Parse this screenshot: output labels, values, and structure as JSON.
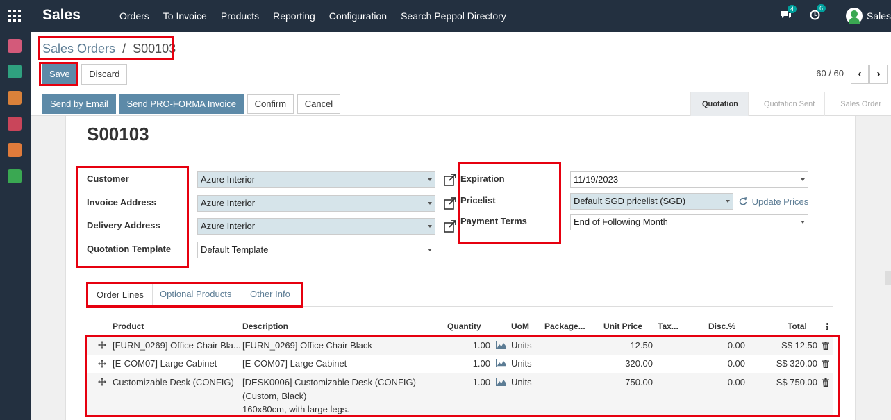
{
  "app": {
    "name": "Sales",
    "menu": [
      "Orders",
      "To Invoice",
      "Products",
      "Reporting",
      "Configuration",
      "Search Peppol Directory"
    ],
    "messages_count": "4",
    "activities_count": "6",
    "user": "Sales"
  },
  "breadcrumb": {
    "parent": "Sales Orders",
    "separator": "/",
    "current": "S00103"
  },
  "buttons": {
    "save": "Save",
    "discard": "Discard"
  },
  "pager": {
    "value": "60 / 60"
  },
  "actions": [
    "Send by Email",
    "Send PRO-FORMA Invoice",
    "Confirm",
    "Cancel"
  ],
  "stages": [
    "Quotation",
    "Quotation Sent",
    "Sales Order"
  ],
  "stage_active": "Quotation",
  "record": {
    "title": "S00103",
    "customer_label": "Customer",
    "customer": "Azure Interior",
    "invoice_label": "Invoice Address",
    "invoice": "Azure Interior",
    "delivery_label": "Delivery Address",
    "delivery": "Azure Interior",
    "template_label": "Quotation Template",
    "template": "Default Template",
    "expiration_label": "Expiration",
    "expiration": "11/19/2023",
    "pricelist_label": "Pricelist",
    "pricelist": "Default SGD pricelist (SGD)",
    "update_prices": "Update Prices",
    "terms_label": "Payment Terms",
    "terms": "End of Following Month"
  },
  "tabs": [
    "Order Lines",
    "Optional Products",
    "Other Info"
  ],
  "columns": [
    "Product",
    "Description",
    "Quantity",
    "UoM",
    "Package...",
    "Unit Price",
    "Tax...",
    "Disc.%",
    "Total"
  ],
  "lines": [
    {
      "product": "[FURN_0269] Office Chair Bla...",
      "description": [
        "[FURN_0269] Office Chair Black"
      ],
      "quantity": "1.00",
      "uom": "Units",
      "unit_price": "12.50",
      "disc": "0.00",
      "total": "S$ 12.50"
    },
    {
      "product": "[E-COM07] Large Cabinet",
      "description": [
        "[E-COM07] Large Cabinet"
      ],
      "quantity": "1.00",
      "uom": "Units",
      "unit_price": "320.00",
      "disc": "0.00",
      "total": "S$ 320.00"
    },
    {
      "product": "Customizable Desk (CONFIG)",
      "description": [
        "[DESK0006] Customizable Desk (CONFIG)",
        "(Custom, Black)",
        "160x80cm, with large legs."
      ],
      "quantity": "1.00",
      "uom": "Units",
      "unit_price": "750.00",
      "disc": "0.00",
      "total": "S$ 750.00"
    }
  ],
  "colors": {
    "navbar": "#233040",
    "primary": "#5d8aa8",
    "highlight": "#e6000f",
    "link": "#5c7c94"
  }
}
